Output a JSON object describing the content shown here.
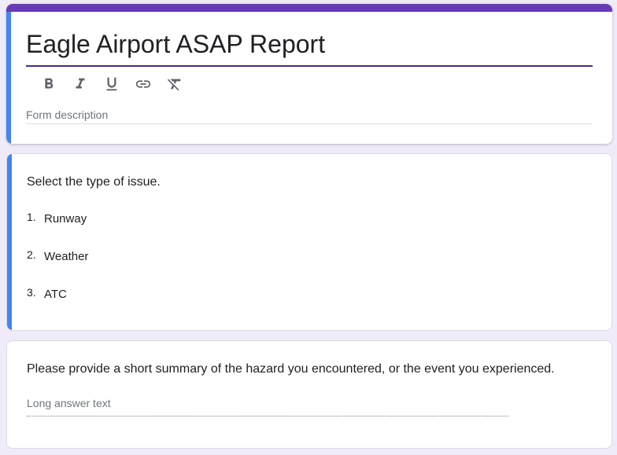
{
  "form": {
    "title": "Eagle Airport ASAP Report",
    "description_placeholder": "Form description",
    "accent_color": "#673ab7",
    "active_bar_color": "#4285f4",
    "background_color": "#efebf8"
  },
  "toolbar": [
    {
      "name": "bold-icon",
      "label": "B"
    },
    {
      "name": "italic-icon",
      "label": "I"
    },
    {
      "name": "underline-icon",
      "label": "U"
    },
    {
      "name": "link-icon",
      "label": "link"
    },
    {
      "name": "clear-format-icon",
      "label": "clear formatting"
    }
  ],
  "questions": [
    {
      "text": "Select the type of issue.",
      "type": "numbered-list",
      "options": [
        {
          "number": "1.",
          "label": "Runway"
        },
        {
          "number": "2.",
          "label": "Weather"
        },
        {
          "number": "3.",
          "label": "ATC"
        }
      ]
    },
    {
      "text": "Please provide a short summary of the hazard you encountered, or the event you experienced.",
      "type": "paragraph",
      "placeholder": "Long answer text"
    }
  ]
}
